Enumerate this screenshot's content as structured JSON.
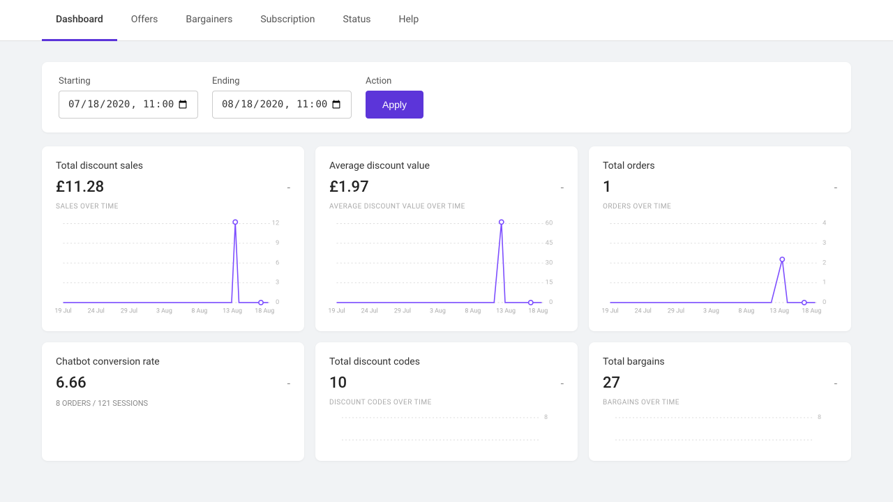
{
  "nav": {
    "tabs": [
      {
        "label": "Dashboard",
        "active": true
      },
      {
        "label": "Offers",
        "active": false
      },
      {
        "label": "Bargainers",
        "active": false
      },
      {
        "label": "Subscription",
        "active": false
      },
      {
        "label": "Status",
        "active": false
      },
      {
        "label": "Help",
        "active": false
      }
    ]
  },
  "filter": {
    "starting_label": "Starting",
    "ending_label": "Ending",
    "action_label": "Action",
    "starting_value": "2020-07-18T23:00",
    "ending_value": "2020-08-18T23:00",
    "apply_label": "Apply"
  },
  "cards": [
    {
      "title": "Total discount sales",
      "value": "£11.28",
      "subtitle": "SALES OVER TIME",
      "has_chart": true,
      "chart_type": "spike"
    },
    {
      "title": "Average discount value",
      "value": "£1.97",
      "subtitle": "AVERAGE DISCOUNT VALUE OVER TIME",
      "has_chart": true,
      "chart_type": "spike"
    },
    {
      "title": "Total orders",
      "value": "1",
      "subtitle": "ORDERS OVER TIME",
      "has_chart": true,
      "chart_type": "spike_small"
    },
    {
      "title": "Chatbot conversion rate",
      "value": "6.66",
      "subtitle": "",
      "note": "8 ORDERS / 121 SESSIONS",
      "has_chart": false
    },
    {
      "title": "Total discount codes",
      "value": "10",
      "subtitle": "DISCOUNT CODES OVER TIME",
      "has_chart": false,
      "partial_chart": true
    },
    {
      "title": "Total bargains",
      "value": "27",
      "subtitle": "BARGAINS OVER TIME",
      "has_chart": false,
      "partial_chart": true
    }
  ],
  "chart_axis_labels": [
    "19 Jul",
    "24 Jul",
    "29 Jul",
    "3 Aug",
    "8 Aug",
    "13 Aug",
    "18 Aug"
  ],
  "chart_y_labels_sales": [
    "12",
    "9",
    "6",
    "3",
    "0"
  ],
  "chart_y_labels_avg": [
    "60",
    "45",
    "30",
    "15",
    "0"
  ],
  "chart_y_labels_orders": [
    "4",
    "3",
    "2",
    "1",
    "0"
  ],
  "chart_y_labels_codes": [
    "8"
  ],
  "chart_y_labels_bargains": [
    "8"
  ]
}
